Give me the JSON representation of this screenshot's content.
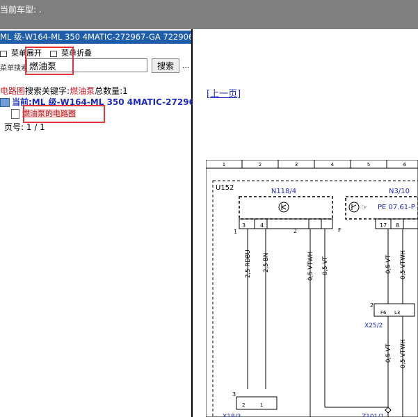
{
  "topbar": {
    "label": "当前车型: ."
  },
  "vehicle_title": "ML 级-W164-ML 350 4MATIC-272967-GA 722906",
  "menu": {
    "expand": "菜单展开",
    "collapse": "菜单折叠"
  },
  "search": {
    "prefix": "菜单搜索",
    "value": "燃油泵",
    "button": "搜索",
    "more": "..."
  },
  "result": {
    "category": "电路图",
    "keyword_label": "搜索关键字:",
    "keyword": "燃油泵",
    "total_label": "总数量:",
    "total": "1"
  },
  "current": {
    "label": "当前:ML 级-W164-ML 350 4MATIC-272967"
  },
  "tree_item": {
    "label": "燃油泵的电路图"
  },
  "page_info": {
    "label": "页号:",
    "value": "1 / 1"
  },
  "right": {
    "prev_link": "[上一页]"
  },
  "diagram": {
    "grid_numbers": [
      "1",
      "2",
      "3",
      "4",
      "5",
      "6"
    ],
    "zone_label": "U152",
    "components": [
      {
        "id": "N118/4"
      },
      {
        "id": "N3/10",
        "ref": "PE 07.61-P"
      }
    ],
    "pins": [
      "3",
      "4",
      "2",
      "F",
      "17",
      "8"
    ],
    "side_labels": [
      "1",
      "2",
      "1",
      "3"
    ],
    "wires": [
      "2,5 RDBU",
      "2,5 BN",
      "0,5 VTWH",
      "0,5 VT",
      "0,5 VT",
      "0,5 VTWH",
      "0,5 VT",
      "0,5 VTWH"
    ],
    "connectors": [
      {
        "id": "X25/2",
        "pins": [
          "F6",
          "L3"
        ]
      },
      {
        "id": "X18/3",
        "pins": [
          "2",
          "1"
        ]
      },
      {
        "id": "Z101/1"
      }
    ]
  }
}
